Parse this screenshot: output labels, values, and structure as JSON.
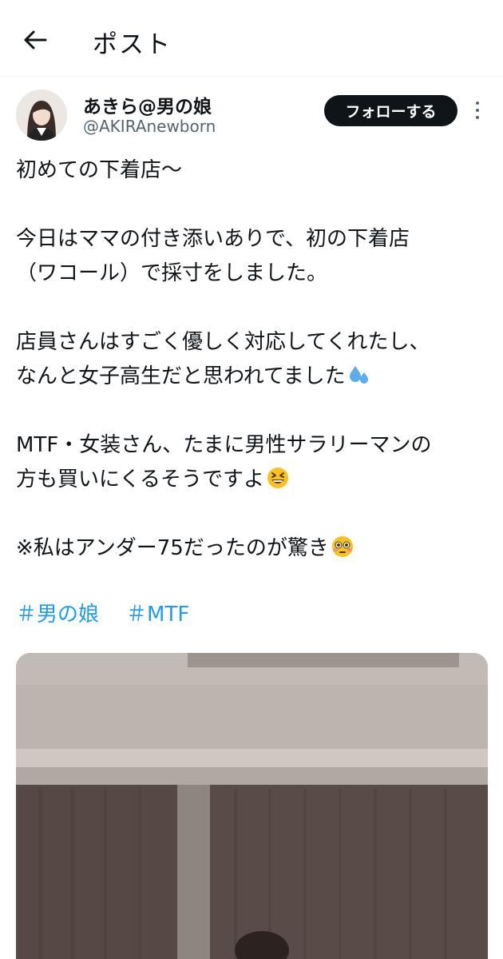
{
  "header": {
    "back_icon": "arrow-left-icon",
    "title": "ポスト"
  },
  "author": {
    "display_name": "あきら@男の娘",
    "handle": "@AKIRAnewborn",
    "follow_label": "フォローする",
    "more_icon": "more-vertical-icon"
  },
  "tweet": {
    "line1": "初めての下着店〜",
    "line2": "今日はママの付き添いありで、初の下着店",
    "line3": "（ワコール）で採寸をしました。",
    "line4": "店員さんはすごく優しく対応してくれたし、",
    "line5": "なんと女子高生だと思われてました",
    "line6": "MTF・女装さん、たまに男性サラリーマンの",
    "line7": "方も買いにくるそうですよ",
    "line8": "※私はアンダー75だったのが驚き",
    "emojis": [
      "sweat-droplets-emoji",
      "grinning-squinting-face-emoji",
      "flushed-face-emoji"
    ]
  },
  "hashtags": [
    "＃男の娘",
    "＃MTF"
  ],
  "colors": {
    "text": "#0f1419",
    "secondary": "#536471",
    "link": "#1d9bf0",
    "follow_bg": "#0f1419",
    "divider": "#eff3f4"
  }
}
